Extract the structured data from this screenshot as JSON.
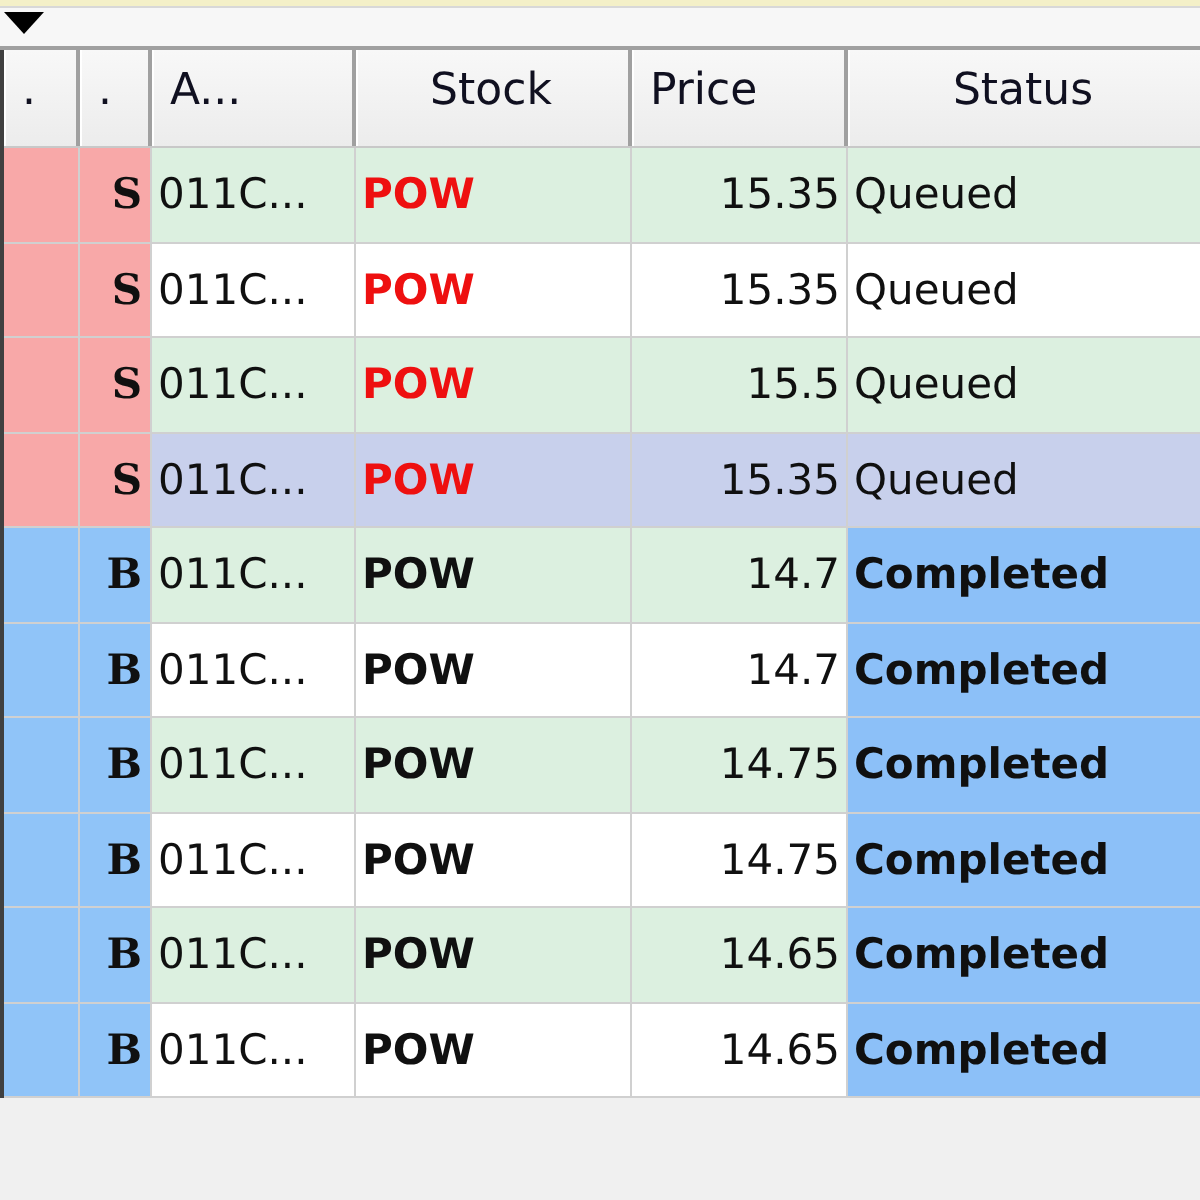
{
  "columns": [
    ".",
    ".",
    "A...",
    "Stock",
    "Price",
    "Status"
  ],
  "rows": [
    {
      "kind": "sell",
      "selected": false,
      "side": "S",
      "account": "011C...",
      "stock": "POW",
      "price": "15.35",
      "status": {
        "kind": "queued",
        "text": "Queued"
      }
    },
    {
      "kind": "sell",
      "selected": false,
      "side": "S",
      "account": "011C...",
      "stock": "POW",
      "price": "15.35",
      "status": {
        "kind": "queued",
        "text": "Queued"
      }
    },
    {
      "kind": "sell",
      "selected": false,
      "side": "S",
      "account": "011C...",
      "stock": "POW",
      "price": "15.5",
      "status": {
        "kind": "queued",
        "text": "Queued"
      }
    },
    {
      "kind": "sell",
      "selected": true,
      "side": "S",
      "account": "011C...",
      "stock": "POW",
      "price": "15.35",
      "status": {
        "kind": "queued",
        "text": "Queued"
      }
    },
    {
      "kind": "buy",
      "selected": false,
      "side": "B",
      "account": "011C...",
      "stock": "POW",
      "price": "14.7",
      "status": {
        "kind": "completed",
        "text": "Completed"
      }
    },
    {
      "kind": "buy",
      "selected": false,
      "side": "B",
      "account": "011C...",
      "stock": "POW",
      "price": "14.7",
      "status": {
        "kind": "completed",
        "text": "Completed"
      }
    },
    {
      "kind": "buy",
      "selected": false,
      "side": "B",
      "account": "011C...",
      "stock": "POW",
      "price": "14.75",
      "status": {
        "kind": "completed",
        "text": "Completed"
      }
    },
    {
      "kind": "buy",
      "selected": false,
      "side": "B",
      "account": "011C...",
      "stock": "POW",
      "price": "14.75",
      "status": {
        "kind": "completed",
        "text": "Completed"
      }
    },
    {
      "kind": "buy",
      "selected": false,
      "side": "B",
      "account": "011C...",
      "stock": "POW",
      "price": "14.65",
      "status": {
        "kind": "completed",
        "text": "Completed"
      }
    },
    {
      "kind": "buy",
      "selected": false,
      "side": "B",
      "account": "011C...",
      "stock": "POW",
      "price": "14.65",
      "status": {
        "kind": "completed",
        "text": "Completed"
      }
    }
  ]
}
